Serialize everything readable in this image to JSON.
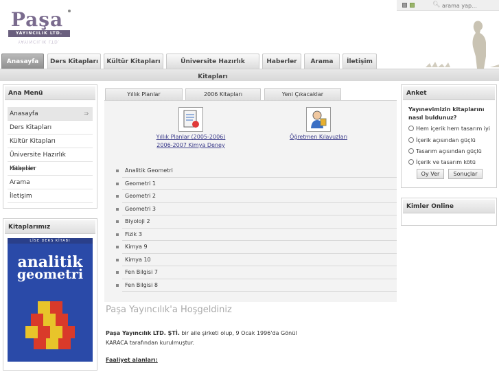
{
  "logo": {
    "text": "Paşa",
    "subtitle": "YAYINCILIK LTD.",
    "reflection": "YAYINCILIK LTD."
  },
  "search": {
    "placeholder": "arama yap..."
  },
  "nav": {
    "tabs": [
      {
        "label": "Anasayfa",
        "active": true
      },
      {
        "label": "Ders Kitapları"
      },
      {
        "label": "Kültür Kitapları"
      },
      {
        "label": "Üniversite Hazırlık Kitapları"
      },
      {
        "label": "Haberler"
      },
      {
        "label": "Arama"
      },
      {
        "label": "İletişim"
      }
    ]
  },
  "sidebar": {
    "menu_title": "Ana Menü",
    "items": [
      {
        "label": "Anasayfa",
        "arrow": "⇒"
      },
      {
        "label": "Ders Kitapları"
      },
      {
        "label": "Kültür Kitapları"
      },
      {
        "label": "Üniversite Hazırlık Kitapları"
      },
      {
        "label": "Haberler"
      },
      {
        "label": "Arama"
      },
      {
        "label": "İletişim"
      }
    ],
    "books_title": "Kitaplarımız",
    "book": {
      "top_text": "LİSE DERS KİTABI",
      "title_line1": "analitik",
      "title_line2": "geometri"
    }
  },
  "center": {
    "tabs": [
      {
        "label": "Yıllık Planlar"
      },
      {
        "label": "2006 Kitapları"
      },
      {
        "label": "Yeni Çıkacaklar"
      }
    ],
    "features": [
      {
        "link1": "Yıllık Planlar (2005-2006)",
        "link2": "2006-2007 Kimya Deney"
      },
      {
        "link1": "Öğretmen Kılavuzları"
      }
    ],
    "list": [
      "Analitik Geometri",
      "Geometri 1",
      "Geometri 2",
      "Geometri 3",
      "Biyoloji 2",
      "Fizik 3",
      "Kimya 9",
      "Kimya 10",
      "Fen Bilgisi 7",
      "Fen Bilgisi 8"
    ],
    "welcome": "Paşa Yayıncılık'a Hoşgeldiniz",
    "about_bold": "Paşa Yayıncılık LTD. ŞTİ.",
    "about_rest": " bir aile şirketi olup, 9 Ocak 1996'da Gönül KARACA tarafından kurulmuştur.",
    "faaliyet": "Faaliyet alanları:"
  },
  "anket": {
    "title": "Anket",
    "question": "Yayınevimizin kitaplarını nasıl buldunuz?",
    "options": [
      "Hem içerik hem tasarım iyi",
      "İçerik açısından güçlü",
      "Tasarım açısından güçlü",
      "İçerik ve tasarım kötü"
    ],
    "vote_label": "Oy Ver",
    "results_label": "Sonuçlar"
  },
  "online": {
    "title": "Kimler Online"
  }
}
